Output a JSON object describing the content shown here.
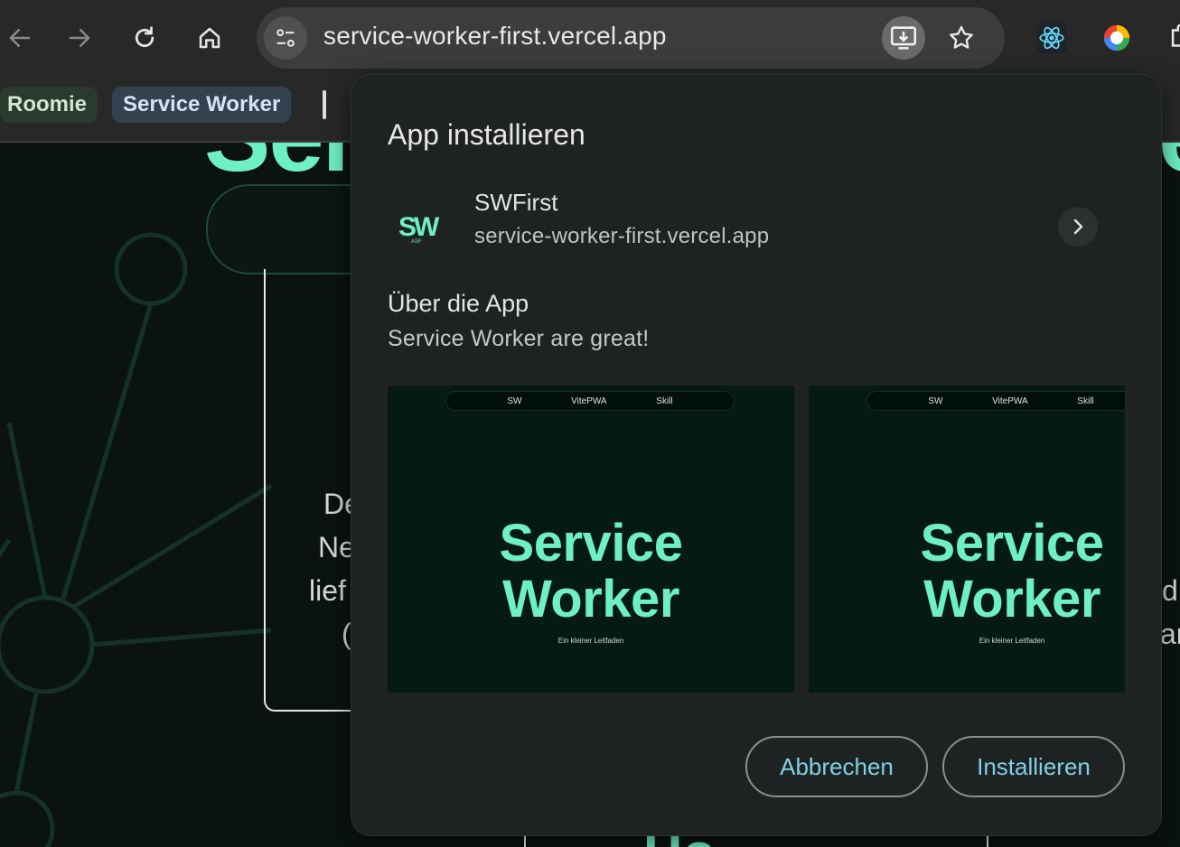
{
  "browser": {
    "url": "service-worker-first.vercel.app",
    "bookmarks": [
      "Roomie",
      "Service Worker"
    ],
    "icons": [
      "back-icon",
      "forward-icon",
      "reload-icon",
      "home-icon",
      "tune-icon",
      "install-app-icon",
      "star-icon",
      "react-devtools-icon",
      "color-picker-icon",
      "extensions-icon"
    ]
  },
  "background_page": {
    "peek_text": [
      "De",
      "Ne",
      "lief",
      "(",
      "d",
      "ar"
    ]
  },
  "dialog": {
    "title": "App installieren",
    "app_name": "SWFirst",
    "app_origin": "service-worker-first.vercel.app",
    "about_heading": "Über die App",
    "about_text": "Service Worker are great!",
    "screenshots": [
      {
        "nav": [
          "SW",
          "VitePWA",
          "Skill"
        ],
        "title_line1": "Service",
        "title_line2": "Worker",
        "subtitle": "Ein kleiner Leitfaden"
      },
      {
        "nav": [
          "SW",
          "VitePWA",
          "Skill"
        ],
        "title_line1": "Service",
        "title_line2": "Worker",
        "subtitle": "Ein kleiner Leitfaden"
      }
    ],
    "cancel_label": "Abbrechen",
    "install_label": "Installieren"
  },
  "colors": {
    "accent_green": "#6ff0c4",
    "button_text": "#7fd1e6",
    "dialog_bg": "#1f2223"
  }
}
